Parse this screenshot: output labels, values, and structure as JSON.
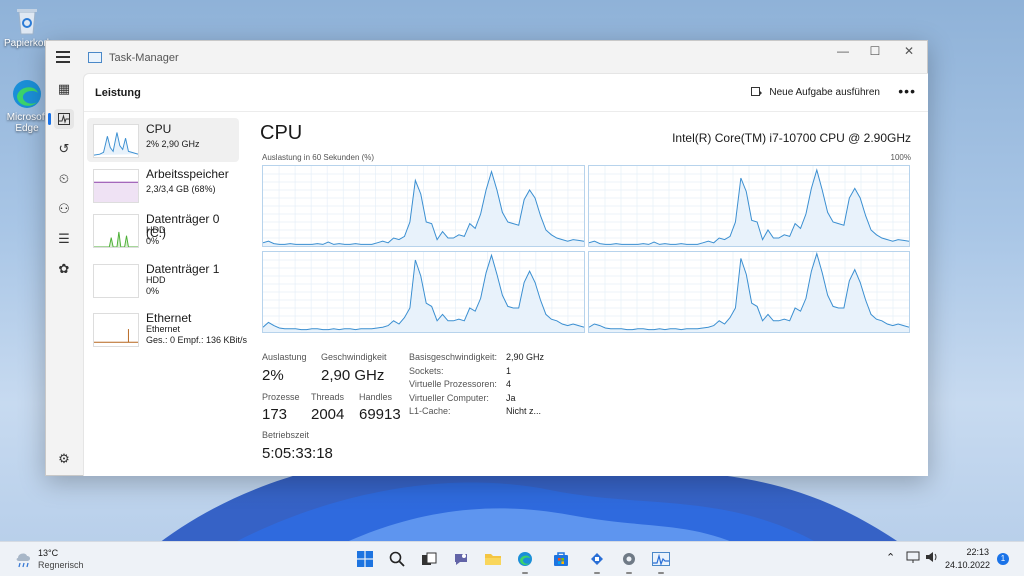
{
  "desktop": {
    "icons": [
      {
        "label": "Papierkorb"
      },
      {
        "label": "Microsoft Edge"
      }
    ]
  },
  "window": {
    "title": "Task-Manager",
    "controls": {
      "minimize": "—",
      "maximize": "☐",
      "close": "✕"
    }
  },
  "nav": {
    "items": [
      "processes-icon",
      "performance-icon",
      "app-history-icon",
      "startup-icon",
      "users-icon",
      "details-icon",
      "services-icon"
    ],
    "settings": "settings-icon"
  },
  "header": {
    "page_title": "Leistung",
    "run_task": "Neue Aufgabe ausführen",
    "more": "•••"
  },
  "resources": [
    {
      "name": "CPU",
      "sub1": "2% 2,90 GHz",
      "sub2": ""
    },
    {
      "name": "Arbeitsspeicher",
      "sub1": "2,3/3,4 GB (68%)",
      "sub2": ""
    },
    {
      "name": "Datenträger 0 (C:)",
      "sub1": "HDD",
      "sub2": "0%"
    },
    {
      "name": "Datenträger 1",
      "sub1": "HDD",
      "sub2": "0%"
    },
    {
      "name": "Ethernet",
      "sub1": "Ethernet",
      "sub2": "Ges.: 0 Empf.: 136 KBit/s"
    }
  ],
  "cpu": {
    "title": "CPU",
    "model": "Intel(R) Core(TM) i7-10700 CPU @ 2.90GHz",
    "graph_label": "Auslastung in 60 Sekunden (%)",
    "graph_max": "100%",
    "core_series": [
      [
        4,
        6,
        3,
        2,
        2,
        3,
        2,
        2,
        2,
        2,
        3,
        2,
        5,
        2,
        3,
        2,
        2,
        3,
        2,
        2,
        2,
        4,
        6,
        4,
        10,
        8,
        12,
        30,
        82,
        65,
        30,
        28,
        8,
        18,
        10,
        10,
        14,
        12,
        28,
        22,
        40,
        70,
        93,
        70,
        42,
        30,
        28,
        26,
        58,
        70,
        60,
        38,
        20,
        14,
        10,
        8,
        6,
        8,
        7,
        6
      ],
      [
        4,
        6,
        3,
        2,
        2,
        3,
        2,
        2,
        2,
        2,
        3,
        2,
        5,
        2,
        3,
        2,
        2,
        3,
        2,
        2,
        2,
        4,
        6,
        4,
        10,
        8,
        12,
        30,
        85,
        68,
        32,
        30,
        8,
        20,
        10,
        10,
        14,
        12,
        28,
        22,
        40,
        72,
        95,
        70,
        42,
        30,
        28,
        26,
        60,
        72,
        60,
        38,
        20,
        14,
        10,
        8,
        6,
        8,
        7,
        6
      ],
      [
        6,
        12,
        8,
        5,
        4,
        4,
        4,
        3,
        3,
        4,
        4,
        3,
        3,
        4,
        3,
        4,
        4,
        3,
        4,
        4,
        4,
        5,
        6,
        8,
        14,
        10,
        18,
        30,
        90,
        70,
        36,
        32,
        14,
        22,
        14,
        14,
        16,
        14,
        30,
        26,
        42,
        74,
        96,
        72,
        46,
        32,
        30,
        30,
        62,
        76,
        62,
        40,
        22,
        16,
        14,
        10,
        8,
        10,
        8,
        6
      ],
      [
        6,
        10,
        8,
        5,
        4,
        4,
        4,
        3,
        3,
        4,
        4,
        3,
        3,
        4,
        3,
        4,
        4,
        3,
        4,
        4,
        4,
        5,
        6,
        8,
        14,
        10,
        18,
        30,
        92,
        72,
        36,
        32,
        14,
        22,
        14,
        14,
        16,
        14,
        30,
        26,
        42,
        76,
        98,
        74,
        46,
        32,
        30,
        30,
        64,
        78,
        62,
        40,
        22,
        16,
        14,
        10,
        8,
        10,
        8,
        6
      ]
    ],
    "stats": {
      "auslastung_label": "Auslastung",
      "auslastung": "2%",
      "speed_label": "Geschwindigkeit",
      "speed": "2,90 GHz",
      "prozesse_label": "Prozesse",
      "prozesse": "173",
      "threads_label": "Threads",
      "threads": "2004",
      "handles_label": "Handles",
      "handles": "69913",
      "uptime_label": "Betriebszeit",
      "uptime": "5:05:33:18"
    },
    "details": [
      {
        "k": "Basisgeschwindigkeit:",
        "v": "2,90 GHz"
      },
      {
        "k": "Sockets:",
        "v": "1"
      },
      {
        "k": "Virtuelle Prozessoren:",
        "v": "4"
      },
      {
        "k": "Virtueller Computer:",
        "v": "Ja"
      },
      {
        "k": "L1-Cache:",
        "v": "Nicht z..."
      }
    ]
  },
  "taskbar": {
    "weather_temp": "13°C",
    "weather_desc": "Regnerisch",
    "time": "22:13",
    "date": "24.10.2022",
    "notifications": "1",
    "apps": [
      "start-icon",
      "search-icon",
      "task-view-icon",
      "chat-icon",
      "file-explorer-icon",
      "edge-icon",
      "store-icon",
      "widgets-icon",
      "settings-icon",
      "task-manager-icon"
    ]
  },
  "colors": {
    "accent": "#1a73e8",
    "cpu_line": "#3b8fd1",
    "cpu_fill": "#e8f2fb",
    "mem": "#8b3fa8",
    "disk": "#4caf35",
    "net": "#b5651d"
  }
}
